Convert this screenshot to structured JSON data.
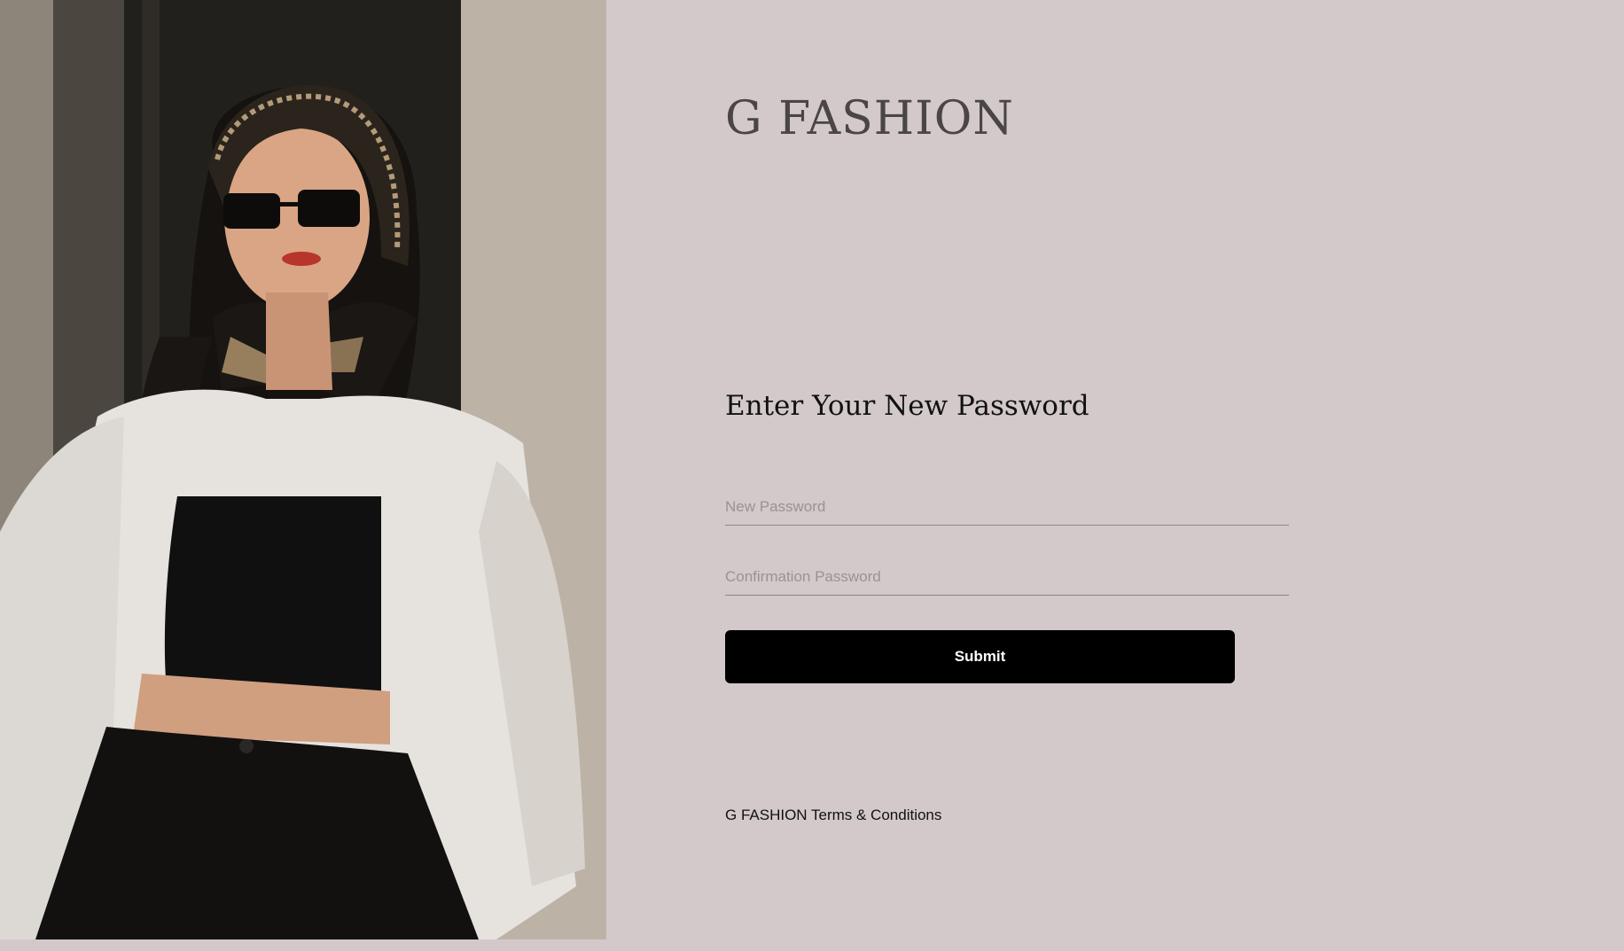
{
  "brand": {
    "name": "G FASHION"
  },
  "form": {
    "title": "Enter Your New Password",
    "new_password_placeholder": "New Password",
    "confirm_password_placeholder": "Confirmation Password",
    "submit_label": "Submit"
  },
  "footer": {
    "terms_link": "G FASHION Terms & Conditions"
  },
  "colors": {
    "background": "#d3c9ca",
    "button_bg": "#000000",
    "button_text": "#ffffff",
    "brand_text": "#4a4547"
  }
}
